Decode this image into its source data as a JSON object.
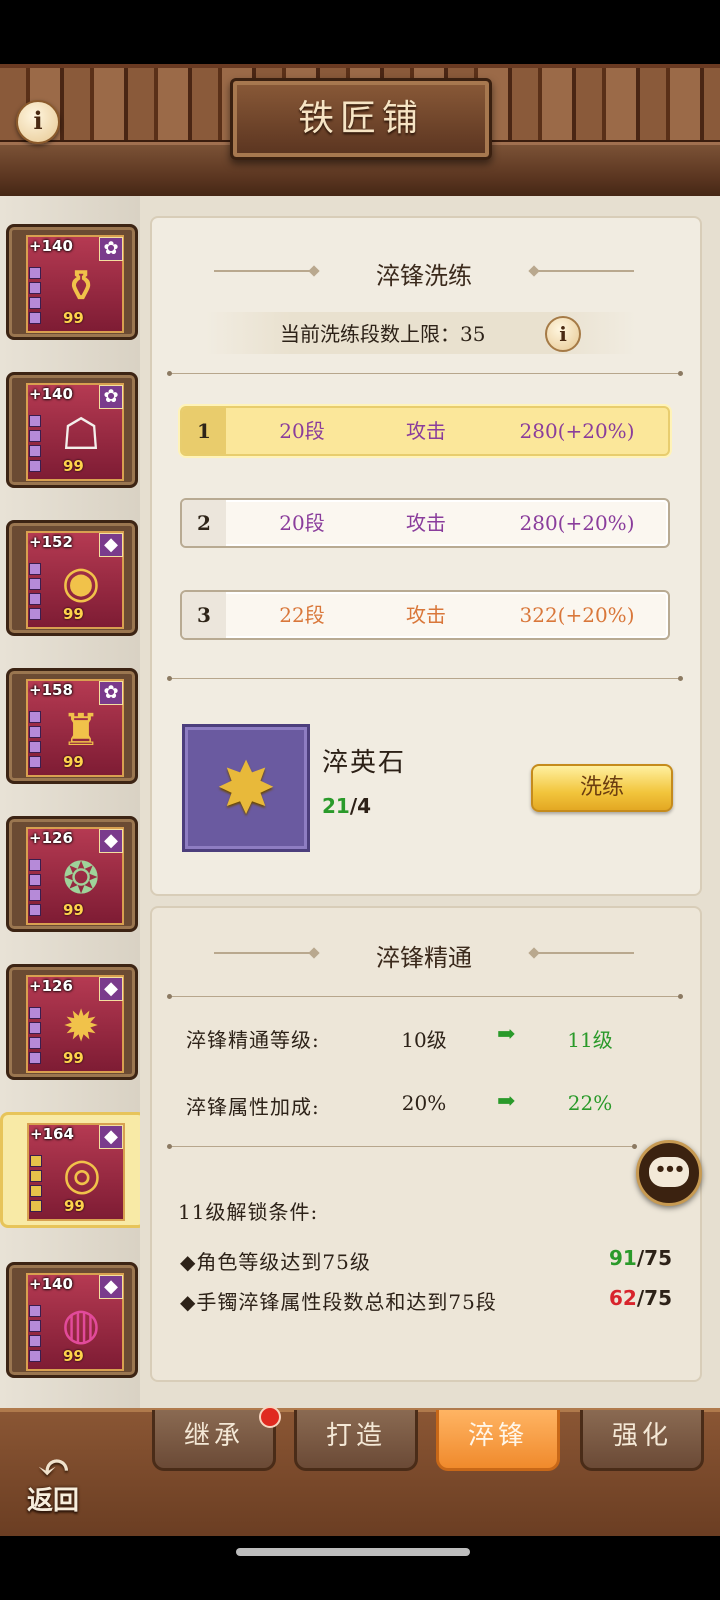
{
  "header": {
    "title": "铁匠铺",
    "info_icon": "info-icon"
  },
  "sidebar": {
    "items": [
      {
        "plus": "+140",
        "badge": "✿",
        "gold": "99",
        "icon": "bracer-icon"
      },
      {
        "plus": "+140",
        "badge": "✿",
        "gold": "99",
        "icon": "robe-icon"
      },
      {
        "plus": "+152",
        "badge": "◆",
        "gold": "99",
        "icon": "belt-icon"
      },
      {
        "plus": "+158",
        "badge": "✿",
        "gold": "99",
        "icon": "boots-icon"
      },
      {
        "plus": "+126",
        "badge": "◆",
        "gold": "99",
        "icon": "necklace-icon"
      },
      {
        "plus": "+126",
        "badge": "◆",
        "gold": "99",
        "icon": "pendant-icon"
      },
      {
        "plus": "+164",
        "badge": "◆",
        "gold": "99",
        "icon": "bracelet-icon",
        "selected": true
      },
      {
        "plus": "+140",
        "badge": "◆",
        "gold": "99",
        "icon": "ring-icon"
      }
    ]
  },
  "refine": {
    "title": "淬锋洗练",
    "limit_label": "当前洗练段数上限：35",
    "rows": [
      {
        "index": "1",
        "segments": "20段",
        "attr": "攻击",
        "value": "280(+20%)",
        "active": true
      },
      {
        "index": "2",
        "segments": "20段",
        "attr": "攻击",
        "value": "280(+20%)"
      },
      {
        "index": "3",
        "segments": "22段",
        "attr": "攻击",
        "value": "322(+20%)"
      }
    ],
    "material": {
      "name": "淬英石",
      "have": "21",
      "need": "/4"
    },
    "button": "洗练"
  },
  "mastery": {
    "title": "淬锋精通",
    "level_label": "淬锋精通等级:",
    "level_current": "10级",
    "level_next": "11级",
    "bonus_label": "淬锋属性加成:",
    "bonus_current": "20%",
    "bonus_next": "22%",
    "unlock_title": "11级解锁条件:",
    "conditions": [
      {
        "text": "◆角色等级达到75级",
        "have": "91",
        "need": "/75",
        "met": true
      },
      {
        "text": "◆手镯淬锋属性段数总和达到75段",
        "have": "62",
        "need": "/75",
        "met": false
      }
    ]
  },
  "tabs": [
    {
      "label": "继承"
    },
    {
      "label": "打造"
    },
    {
      "label": "淬锋",
      "active": true
    },
    {
      "label": "强化"
    }
  ],
  "back": {
    "label": "返回"
  },
  "colors": {
    "accent": "#f08a2c",
    "met": "#2a9a2a",
    "unmet": "#d8242c",
    "purple": "#8a3d9c"
  }
}
